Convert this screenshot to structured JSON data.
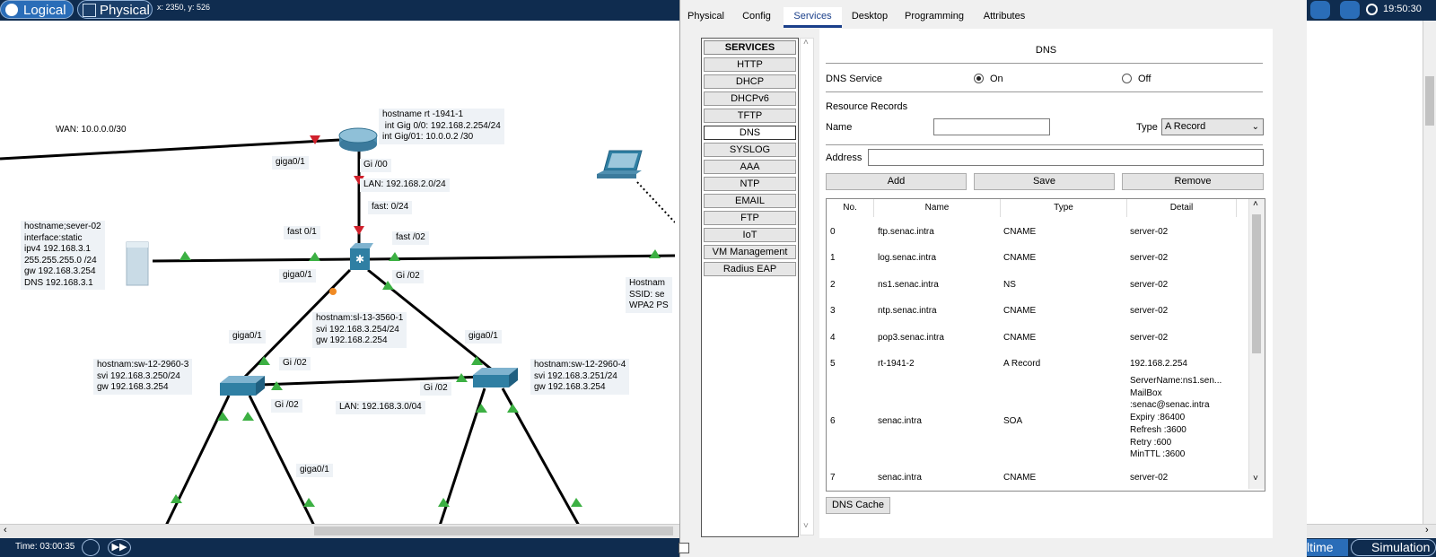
{
  "topbar": {
    "logical_label": "Logical",
    "physical_label": "Physical",
    "coords": "x: 2350, y: 526",
    "clock": "19:50:30"
  },
  "canvas": {
    "wan_label": "WAN: 10.0.0.0/30",
    "router_label": "hostname rt -1941-1\n int Gig 0/0: 192.168.2.254/24\nint Gig/01: 10.0.0.2 /30",
    "giga01_a": "giga0/1",
    "gi00": "Gi /00",
    "lan2": "LAN: 192.168.2.0/24",
    "fast024": "fast: 0/24",
    "server_label": "hostname;sever-02\ninterface:static\nipv4 192.168.3.1\n255.255.255.0 /24\ngw 192.168.3.254\nDNS 192.168.3.1",
    "fast01": "fast 0/1",
    "fast02": "fast /02",
    "giga01_b": "giga0/1",
    "gi02_a": "Gi /02",
    "sl_label": "hostnam:sl-13-3560-1\nsvi 192.168.3.254/24\ngw 192.168.2.254",
    "giga01_c": "giga0/1",
    "giga01_d": "giga0/1",
    "sw3_label": "hostnam:sw-12-2960-3\nsvi 192.168.3.250/24\ngw 192.168.3.254",
    "sw4_label": "hostnam:sw-12-2960-4\nsvi 192.168.3.251/24\ngw 192.168.3.254",
    "gi02_b": "Gi /02",
    "gi02_c": "Gi /02",
    "gi02_d": "Gi /02",
    "lan3": "LAN: 192.168.3.0/04",
    "giga01_e": "giga0/1",
    "ap_label": "Hostnam\nSSID: se\nWPA2 PS"
  },
  "bottombar": {
    "time": "Time: 03:00:35",
    "realtime": "ltime",
    "simulation": "Simulation"
  },
  "dialog": {
    "tabs": [
      "Physical",
      "Config",
      "Services",
      "Desktop",
      "Programming",
      "Attributes"
    ],
    "services_header": "SERVICES",
    "services": [
      "HTTP",
      "DHCP",
      "DHCPv6",
      "TFTP",
      "DNS",
      "SYSLOG",
      "AAA",
      "NTP",
      "EMAIL",
      "FTP",
      "IoT",
      "VM Management",
      "Radius EAP"
    ],
    "dns": {
      "title": "DNS",
      "service_label": "DNS Service",
      "on_label": "On",
      "off_label": "Off",
      "service_state": "On",
      "resource_records_label": "Resource Records",
      "name_label": "Name",
      "name_value": "",
      "type_label": "Type",
      "type_value": "A Record",
      "address_label": "Address",
      "address_value": "",
      "add_label": "Add",
      "save_label": "Save",
      "remove_label": "Remove",
      "columns": [
        "No.",
        "Name",
        "Type",
        "Detail"
      ],
      "rows": [
        {
          "no": "0",
          "name": "ftp.senac.intra",
          "type": "CNAME",
          "detail": "server-02"
        },
        {
          "no": "1",
          "name": "log.senac.intra",
          "type": "CNAME",
          "detail": "server-02"
        },
        {
          "no": "2",
          "name": "ns1.senac.intra",
          "type": "NS",
          "detail": "server-02"
        },
        {
          "no": "3",
          "name": "ntp.senac.intra",
          "type": "CNAME",
          "detail": "server-02"
        },
        {
          "no": "4",
          "name": "pop3.senac.intra",
          "type": "CNAME",
          "detail": "server-02"
        },
        {
          "no": "5",
          "name": "rt-1941-2",
          "type": "A Record",
          "detail": "192.168.2.254"
        },
        {
          "no": "6",
          "name": "senac.intra",
          "type": "SOA",
          "detail": "ServerName:ns1.sen...\nMailBox\n:senac@senac.intra\nExpiry :86400\nRefresh :3600\nRetry :600\nMinTTL :3600"
        },
        {
          "no": "7",
          "name": "senac.intra",
          "type": "CNAME",
          "detail": "server-02"
        }
      ],
      "cache_label": "DNS Cache"
    }
  },
  "colors": {
    "topbar": "#0f2c4f",
    "link_up": "#3cb043",
    "link_down": "#d0202b",
    "device": "#2f7fa3"
  }
}
